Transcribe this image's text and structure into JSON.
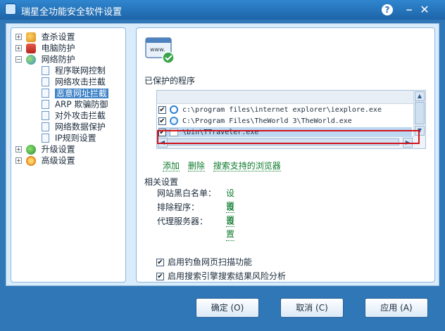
{
  "window": {
    "title": "瑞星全功能安全软件设置",
    "help_label": "?",
    "minimize_label": "−",
    "close_label": "✕"
  },
  "tree": {
    "items": [
      {
        "label": "查杀设置",
        "expander": "+"
      },
      {
        "label": "电脑防护",
        "expander": "+"
      },
      {
        "label": "网络防护",
        "expander": "−"
      },
      {
        "label": "程序联网控制"
      },
      {
        "label": "网络攻击拦截"
      },
      {
        "label": "恶意网址拦截",
        "selected": true
      },
      {
        "label": "ARP 欺骗防御"
      },
      {
        "label": "对外攻击拦截"
      },
      {
        "label": "网络数据保护"
      },
      {
        "label": "IP规则设置"
      },
      {
        "label": "升级设置",
        "expander": "+"
      },
      {
        "label": "高级设置",
        "expander": "+"
      }
    ]
  },
  "main": {
    "header_icon_text": "www.",
    "protected_title": "已保护的程序",
    "programs": [
      {
        "checked": true,
        "path": "c:\\program files\\internet explorer\\iexplore.exe",
        "icon": "ie-icon"
      },
      {
        "checked": true,
        "path": "C:\\Program Files\\TheWorld 3\\TheWorld.exe",
        "icon": "theworld-icon"
      },
      {
        "checked": true,
        "path": "\\bin\\TTraveler.exe",
        "icon": "blank-app-icon"
      }
    ],
    "actions": {
      "add": "添加",
      "delete": "删除",
      "search_browsers": "搜索支持的浏览器"
    },
    "related_title": "相关设置",
    "settings": [
      {
        "label": "网站黑白名单：",
        "link": "设置"
      },
      {
        "label": "排除程序：",
        "link": "设置"
      },
      {
        "label": "代理服务器：",
        "link": "设置"
      }
    ],
    "options": [
      {
        "label": "启用钓鱼网页扫描功能",
        "checked": true
      },
      {
        "label": "启用搜索引擎搜索结果风险分析",
        "checked": true
      }
    ]
  },
  "buttons": {
    "ok": "确定 (O)",
    "cancel": "取消 (C)",
    "apply": "应用 (A)"
  },
  "colors": {
    "title_bar": "#1e64a8",
    "panel_bg": "#d9ecfb",
    "link": "#0c7a2b",
    "highlight_box": "#d0121b",
    "selected_item": "#3d82c7"
  }
}
